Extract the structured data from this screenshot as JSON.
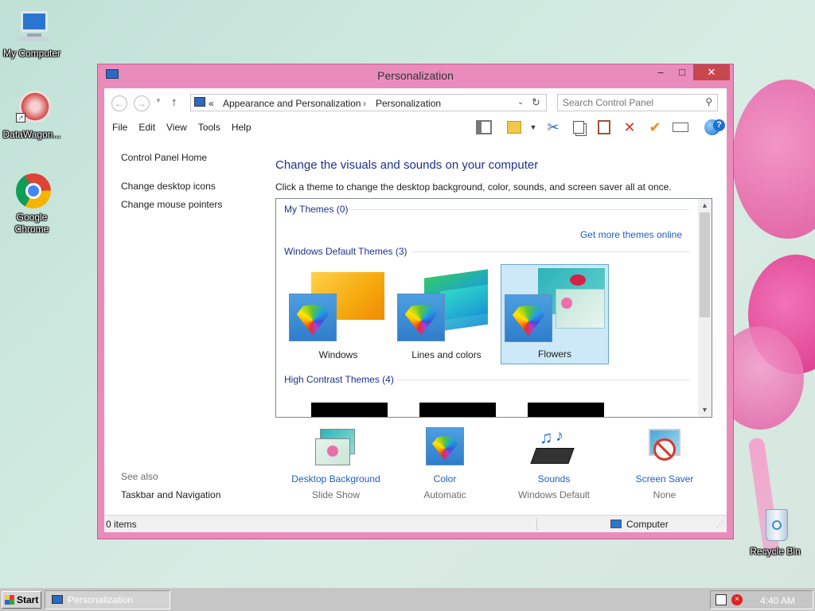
{
  "desktop": {
    "icons": [
      {
        "label": "My Computer"
      },
      {
        "label": "DataWagon..."
      },
      {
        "label": "Google Chrome"
      },
      {
        "label": "Recycle Bin"
      }
    ]
  },
  "window": {
    "title": "Personalization",
    "buttons": {
      "minimize": "–",
      "maximize": "□",
      "close": "✕"
    },
    "address": {
      "prefix": "«",
      "crumbs": [
        "Appearance and Personalization",
        "Personalization"
      ],
      "separator": "›"
    },
    "search": {
      "placeholder": "Search Control Panel"
    },
    "menu": [
      "File",
      "Edit",
      "View",
      "Tools",
      "Help"
    ],
    "left_pane": {
      "links": [
        "Control Panel Home",
        "Change desktop icons",
        "Change mouse pointers"
      ],
      "see_also_label": "See also",
      "see_also_links": [
        "Taskbar and Navigation"
      ]
    },
    "main": {
      "heading": "Change the visuals and sounds on your computer",
      "subheading": "Click a theme to change the desktop background, color, sounds, and screen saver all at once.",
      "groups": {
        "my_themes": "My Themes (0)",
        "get_more": "Get more themes online",
        "default_themes": "Windows Default Themes (3)",
        "high_contrast": "High Contrast Themes (4)"
      },
      "themes": [
        {
          "name": "Windows",
          "selected": false
        },
        {
          "name": "Lines and colors",
          "selected": false
        },
        {
          "name": "Flowers",
          "selected": true
        }
      ],
      "settings": [
        {
          "label": "Desktop Background",
          "value": "Slide Show",
          "icon": "desktop-background-icon"
        },
        {
          "label": "Color",
          "value": "Automatic",
          "icon": "color-palette-icon"
        },
        {
          "label": "Sounds",
          "value": "Windows Default",
          "icon": "sounds-icon"
        },
        {
          "label": "Screen Saver",
          "value": "None",
          "icon": "screen-saver-icon"
        }
      ]
    },
    "status": {
      "items": "0 items",
      "location": "Computer"
    }
  },
  "taskbar": {
    "start_label": "Start",
    "task": "Personalization",
    "clock": "4:40 AM"
  },
  "colors": {
    "window_frame": "#e98cbb",
    "close_button": "#c7474f",
    "link_blue": "#1e5fc0",
    "heading_blue": "#1e3287",
    "selected_theme": "#cde8f7"
  }
}
